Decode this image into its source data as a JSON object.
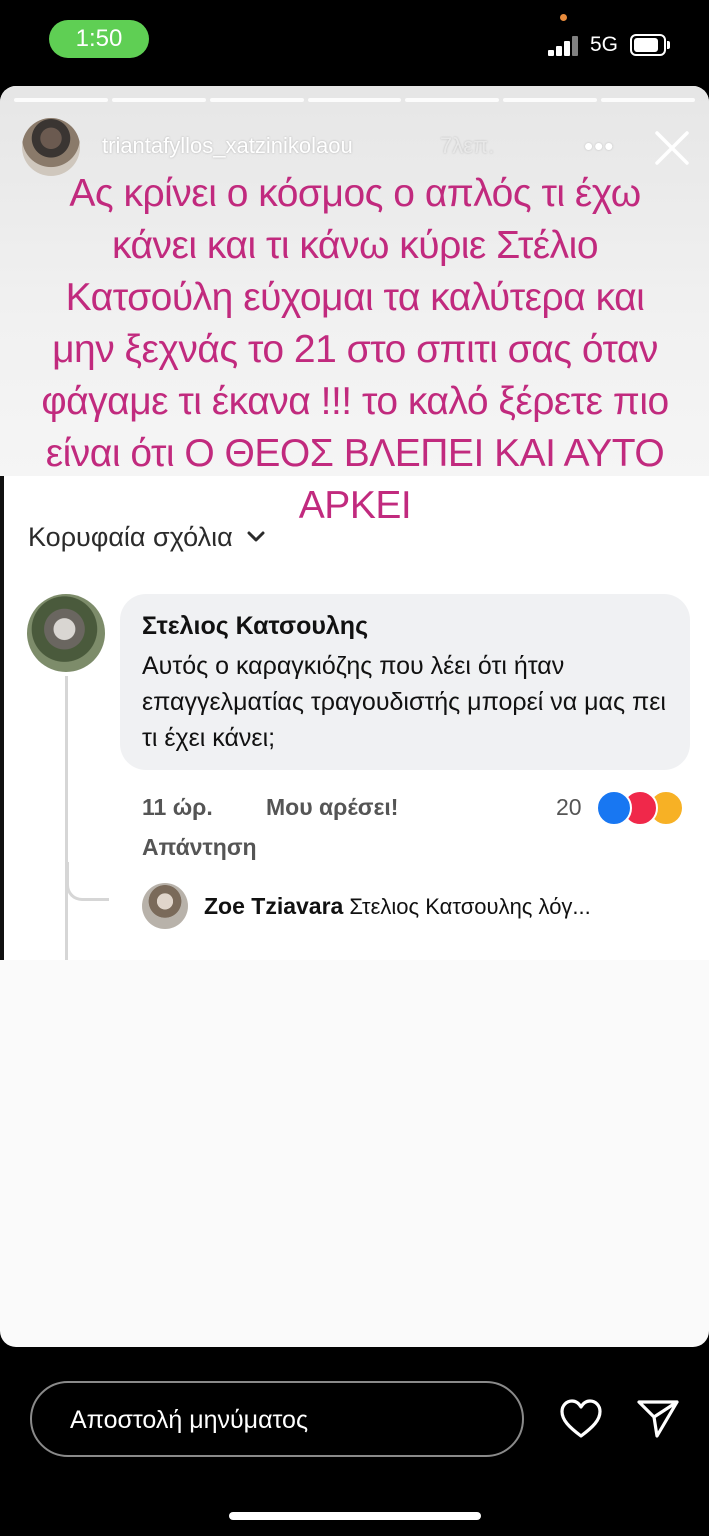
{
  "status_bar": {
    "time": "1:50",
    "network": "5G",
    "accent_time_pill": "#5fcf54"
  },
  "story": {
    "username": "triantafyllos_xatzinikolaou",
    "time_ago": "7λεπ.",
    "more_icon": "more-horizontal-icon",
    "close_icon": "close-icon",
    "progress_segments": 7,
    "overlay_color": "#c12a7e",
    "overlay_text": "Ας κρίνει ο κόσμος ο απλός τι έχω κάνει και τι κάνω κύριε Στέλιο Κατσούλη εύχομαι τα καλύτερα και μην ξεχνάς το 21 στο σπιτι σας όταν φάγαμε τι έκανα !!! το καλό ξέρετε πιο είναι ότι Ο ΘΕΟΣ ΒΛΕΠΕΙ ΚΑΙ ΑΥΤΟ ΑΡΚΕΙ"
  },
  "fb_comment": {
    "section_label": "Κορυφαία σχόλια",
    "commenter_name": "Στελιος Κατσουλης",
    "comment_text": "Αυτός ο καραγκιόζης που λέει ότι ήταν επαγγελματίας τραγουδιστής μπορεί να μας πει τι έχει κάνει;",
    "time": "11 ώρ.",
    "like_label": "Μου αρέσει!",
    "reply_label": "Απάντηση",
    "reaction_count": "20",
    "reactions": [
      "like",
      "love",
      "haha"
    ],
    "reply": {
      "author": "Zoe Tziavara",
      "preview": "Στελιος Κατσουλης λόγ..."
    }
  },
  "bottom_bar": {
    "message_placeholder": "Αποστολή μηνύματος",
    "heart_icon": "heart-icon",
    "send_icon": "send-icon"
  }
}
